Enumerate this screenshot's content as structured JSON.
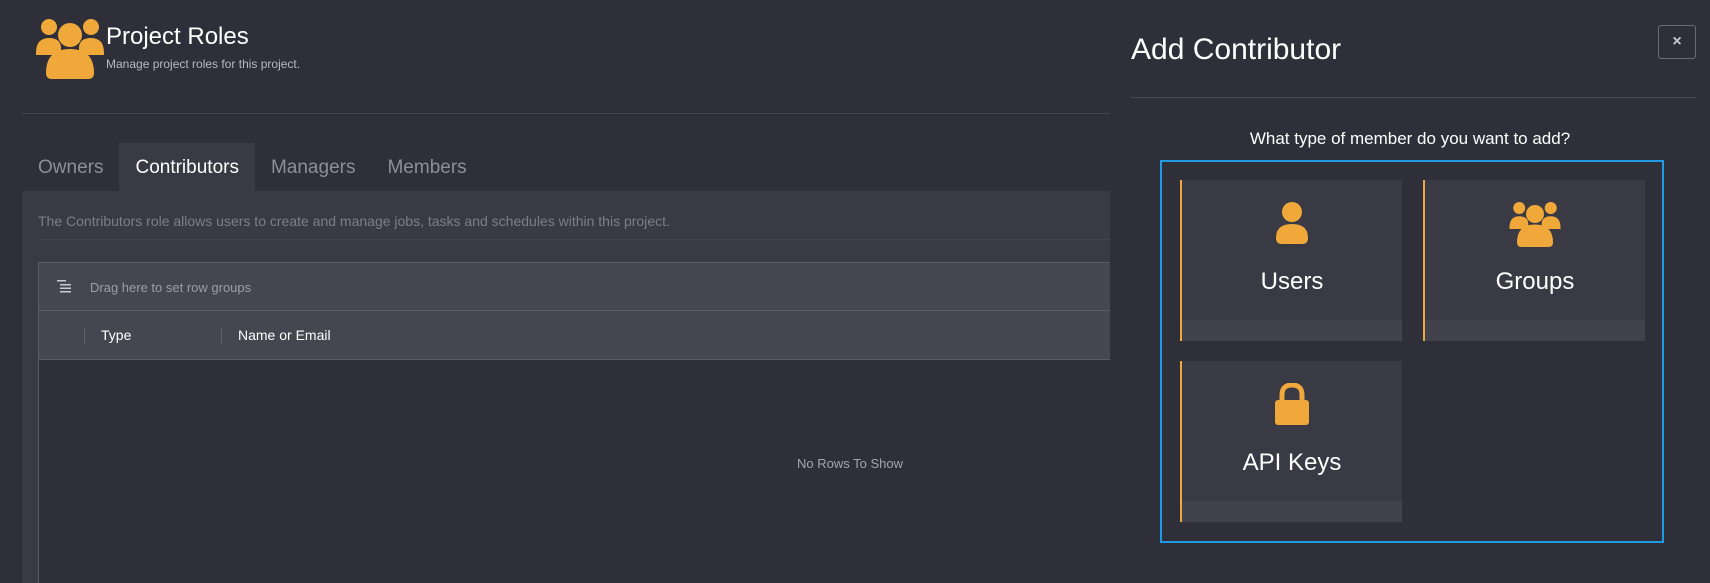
{
  "page": {
    "title": "Project Roles",
    "subtitle": "Manage project roles for this project."
  },
  "tabs": [
    {
      "label": "Owners",
      "active": false
    },
    {
      "label": "Contributors",
      "active": true
    },
    {
      "label": "Managers",
      "active": false
    },
    {
      "label": "Members",
      "active": false
    }
  ],
  "role_description": "The Contributors role allows users to create and manage jobs, tasks and schedules within this project.",
  "grid": {
    "group_bar_text": "Drag here to set row groups",
    "columns": [
      "Type",
      "Name or Email"
    ],
    "empty_text": "No Rows To Show"
  },
  "drawer": {
    "title": "Add Contributor",
    "close_label": "×",
    "question": "What type of member do you want to add?",
    "options": [
      {
        "label": "Users",
        "icon": "user-icon"
      },
      {
        "label": "Groups",
        "icon": "group-icon"
      },
      {
        "label": "API Keys",
        "icon": "lock-icon"
      }
    ]
  },
  "colors": {
    "accent": "#f0a83a",
    "highlight_border": "#1f9be6",
    "background": "#2e2f38",
    "panel": "#393a44"
  }
}
